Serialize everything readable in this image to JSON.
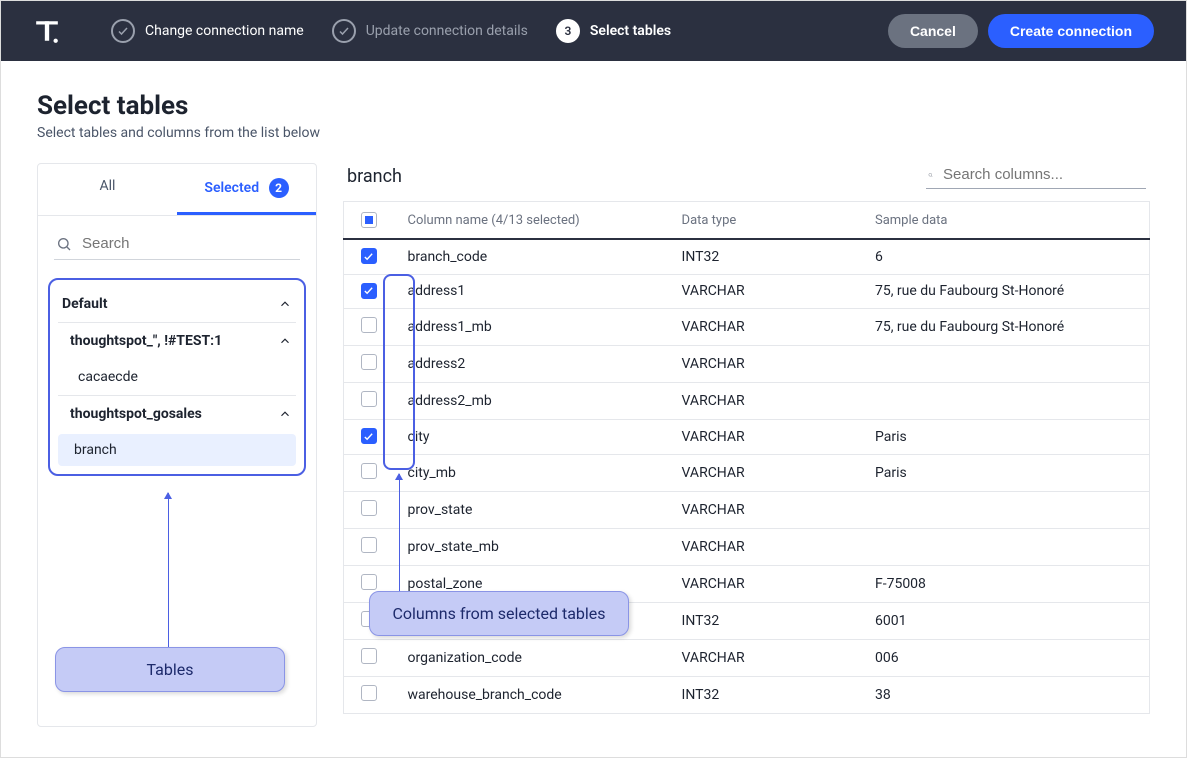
{
  "header": {
    "steps": [
      {
        "label": "Change connection name",
        "state": "done"
      },
      {
        "label": "Update connection details",
        "state": "muted"
      },
      {
        "label": "Select tables",
        "state": "active",
        "num": "3"
      }
    ],
    "cancel": "Cancel",
    "create": "Create connection"
  },
  "page": {
    "title": "Select tables",
    "subtitle": "Select tables and columns from the list below"
  },
  "sidebar": {
    "tabs": {
      "all": "All",
      "selected": "Selected",
      "count": "2"
    },
    "search_placeholder": "Search",
    "tree": {
      "root": "Default",
      "group1": "thoughtspot_\", !#TEST:1",
      "group1_child": "cacaecde",
      "group2": "thoughtspot_gosales",
      "group2_child": "branch"
    }
  },
  "table": {
    "name": "branch",
    "search_placeholder": "Search columns...",
    "header": {
      "col": "Column name (4/13 selected)",
      "type": "Data type",
      "sample": "Sample data"
    },
    "rows": [
      {
        "checked": true,
        "name": "branch_code",
        "type": "INT32",
        "sample": "6"
      },
      {
        "checked": true,
        "name": "address1",
        "type": "VARCHAR",
        "sample": "75, rue du Faubourg St-Honoré"
      },
      {
        "checked": false,
        "name": "address1_mb",
        "type": "VARCHAR",
        "sample": "75, rue du Faubourg St-Honoré"
      },
      {
        "checked": false,
        "name": "address2",
        "type": "VARCHAR",
        "sample": ""
      },
      {
        "checked": false,
        "name": "address2_mb",
        "type": "VARCHAR",
        "sample": ""
      },
      {
        "checked": true,
        "name": "city",
        "type": "VARCHAR",
        "sample": "Paris"
      },
      {
        "checked": false,
        "name": "city_mb",
        "type": "VARCHAR",
        "sample": "Paris"
      },
      {
        "checked": false,
        "name": "prov_state",
        "type": "VARCHAR",
        "sample": ""
      },
      {
        "checked": false,
        "name": "prov_state_mb",
        "type": "VARCHAR",
        "sample": ""
      },
      {
        "checked": false,
        "name": "postal_zone",
        "type": "VARCHAR",
        "sample": "F-75008"
      },
      {
        "checked": false,
        "name": "",
        "type": "INT32",
        "sample": "6001"
      },
      {
        "checked": false,
        "name": "organization_code",
        "type": "VARCHAR",
        "sample": "006"
      },
      {
        "checked": false,
        "name": "warehouse_branch_code",
        "type": "INT32",
        "sample": "38"
      }
    ]
  },
  "annotations": {
    "tables": "Tables",
    "columns": "Columns from selected tables"
  }
}
